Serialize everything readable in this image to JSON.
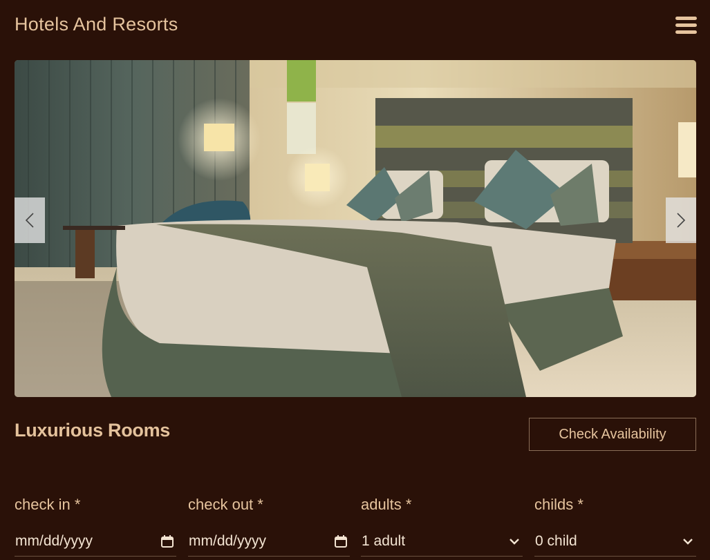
{
  "header": {
    "title": "Hotels And Resorts",
    "menu_icon": "hamburger-menu-icon"
  },
  "slider": {
    "image_alt": "hotel bedroom",
    "prev_icon": "chevron-left-icon",
    "next_icon": "chevron-right-icon"
  },
  "section": {
    "title": "Luxurious Rooms",
    "cta_label": "Check Availability"
  },
  "booking": {
    "fields": [
      {
        "label": "check in *",
        "value": "mm/dd/yyyy",
        "icon": "calendar-icon"
      },
      {
        "label": "check out *",
        "value": "mm/dd/yyyy",
        "icon": "calendar-icon"
      },
      {
        "label": "adults *",
        "value": "1 adult",
        "icon": "chevron-down-icon"
      },
      {
        "label": "childs *",
        "value": "0 child",
        "icon": "chevron-down-icon"
      }
    ]
  },
  "colors": {
    "background": "#2a1108",
    "accent_text": "#e6c49e",
    "border": "#8b6f58"
  }
}
